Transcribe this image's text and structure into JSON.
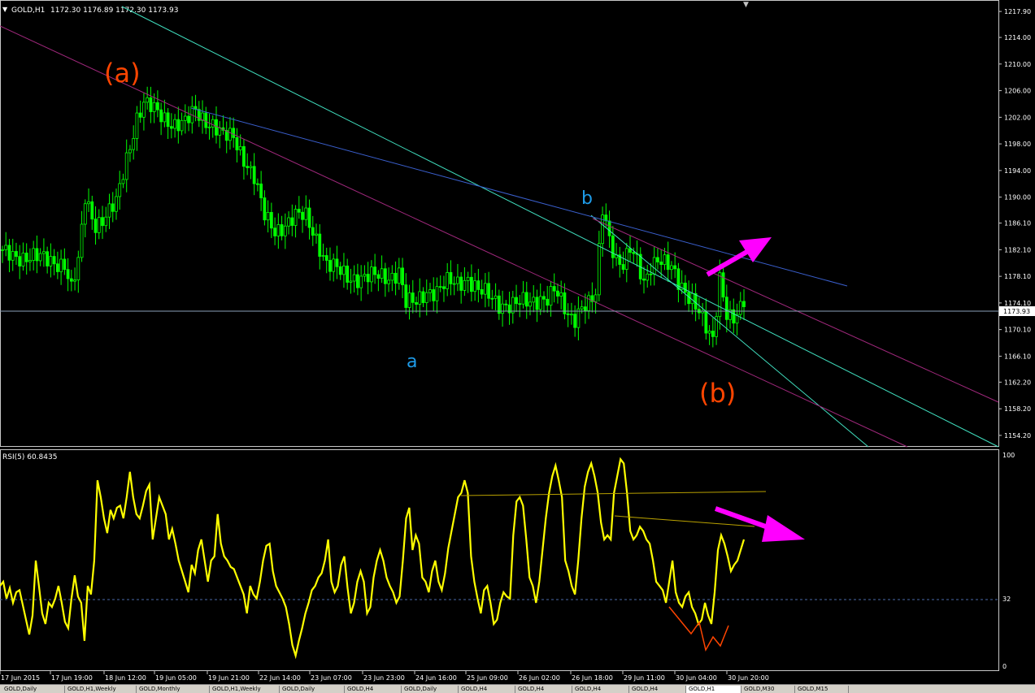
{
  "header": {
    "symbol_label": "GOLD,H1",
    "ohlc": "1172.30 1176.89 1172.30 1173.93"
  },
  "indicator": {
    "label": "RSI(5) 60.8435",
    "level_label": "32"
  },
  "annotations": {
    "wave_a_big": "(a)",
    "wave_b_big": "(b)",
    "wave_a_small": "a",
    "wave_b_small": "b"
  },
  "colors": {
    "background": "#000000",
    "candles": "#00ff00",
    "rsi_line": "#ffff00",
    "wave_big": "#ff4500",
    "wave_small": "#1e9be8",
    "arrow": "#ff00ff",
    "channel_cyan": "#40e0c0",
    "channel_magenta": "#a0287c",
    "trendline_blue": "#3a5fcd"
  },
  "tabs": [
    "GOLD,Daily",
    "GOLD,H1,Weekly",
    "GOLD,Monthly",
    "GOLD,H1,Weekly",
    "GOLD,Daily",
    "GOLD,H4",
    "GOLD,Daily",
    "GOLD,H4",
    "GOLD,H4",
    "GOLD,H4",
    "GOLD,H4",
    "GOLD,H1",
    "GOLD,M30",
    "GOLD,M15"
  ],
  "active_tab": 11,
  "chart_data": [
    {
      "type": "candlestick",
      "title": "GOLD,H1",
      "y_ticks": [
        "1217.90",
        "1214.00",
        "1210.00",
        "1206.00",
        "1202.00",
        "1198.00",
        "1194.00",
        "1190.00",
        "1186.10",
        "1182.10",
        "1178.10",
        "1174.10",
        "1170.10",
        "1166.10",
        "1162.20",
        "1158.20",
        "1154.20"
      ],
      "ylim": [
        1152.6,
        1219.5
      ],
      "current_price": "1173.93",
      "x_ticks": [
        "17 Jun 2015",
        "17 Jun 19:00",
        "18 Jun 12:00",
        "19 Jun 05:00",
        "19 Jun 21:00",
        "22 Jun 14:00",
        "23 Jun 07:00",
        "23 Jun 23:00",
        "24 Jun 16:00",
        "25 Jun 09:00",
        "26 Jun 02:00",
        "26 Jun 18:00",
        "29 Jun 11:00",
        "30 Jun 04:00",
        "30 Jun 20:00"
      ],
      "close_path": [
        [
          0,
          1181.5
        ],
        [
          8,
          1181
        ],
        [
          14,
          1180.5
        ],
        [
          18,
          1180
        ],
        [
          20,
          1176
        ],
        [
          22,
          1180
        ],
        [
          24,
          1190
        ],
        [
          27,
          1186
        ],
        [
          30,
          1187
        ],
        [
          33,
          1189
        ],
        [
          36,
          1196
        ],
        [
          39,
          1202
        ],
        [
          41,
          1204
        ],
        [
          44,
          1203
        ],
        [
          47,
          1202
        ],
        [
          50,
          1201
        ],
        [
          53,
          1201
        ],
        [
          56,
          1203
        ],
        [
          58,
          1202
        ],
        [
          61,
          1201
        ],
        [
          64,
          1199
        ],
        [
          67,
          1199
        ],
        [
          70,
          1196
        ],
        [
          73,
          1193
        ],
        [
          76,
          1187
        ],
        [
          79,
          1185
        ],
        [
          82,
          1186
        ],
        [
          85,
          1187
        ],
        [
          88,
          1187
        ],
        [
          91,
          1184
        ],
        [
          94,
          1180
        ],
        [
          97,
          1179
        ],
        [
          100,
          1178
        ],
        [
          103,
          1178
        ],
        [
          106,
          1178
        ],
        [
          109,
          1178
        ],
        [
          112,
          1178
        ],
        [
          115,
          1179
        ],
        [
          117,
          1174
        ],
        [
          120,
          1174
        ],
        [
          123,
          1176
        ],
        [
          126,
          1176
        ],
        [
          129,
          1177
        ],
        [
          132,
          1177
        ],
        [
          135,
          1178
        ],
        [
          138,
          1176
        ],
        [
          141,
          1175
        ],
        [
          144,
          1174
        ],
        [
          147,
          1174
        ],
        [
          150,
          1174
        ],
        [
          153,
          1174
        ],
        [
          156,
          1175
        ],
        [
          158,
          1175
        ],
        [
          160,
          1176
        ],
        [
          162,
          1174
        ],
        [
          164,
          1172
        ],
        [
          166,
          1172
        ],
        [
          168,
          1174
        ],
        [
          170,
          1174
        ],
        [
          172,
          1175
        ],
        [
          174,
          1188
        ],
        [
          176,
          1184
        ],
        [
          178,
          1181
        ],
        [
          180,
          1180
        ],
        [
          182,
          1182
        ],
        [
          184,
          1180
        ],
        [
          186,
          1177
        ],
        [
          188,
          1180
        ],
        [
          190,
          1181
        ],
        [
          192,
          1180
        ],
        [
          194,
          1179
        ],
        [
          196,
          1177
        ],
        [
          198,
          1176
        ],
        [
          200,
          1175
        ],
        [
          202,
          1173
        ],
        [
          204,
          1170
        ],
        [
          206,
          1168
        ],
        [
          208,
          1178
        ],
        [
          210,
          1173
        ],
        [
          212,
          1172
        ],
        [
          214,
          1173
        ],
        [
          215,
          1174
        ]
      ],
      "price_range": {
        "high": "1206 (18 Jun)",
        "low": "1166 (30 Jun)"
      }
    },
    {
      "type": "line",
      "title": "RSI(5) 60.8435",
      "y_ticks": [
        "100",
        "32",
        "0"
      ],
      "ylim": [
        0,
        100
      ],
      "level": 32,
      "series": [
        {
          "values": [
            38,
            40,
            32,
            37,
            30,
            35,
            36,
            29,
            22,
            15,
            24,
            50,
            38,
            25,
            20,
            30,
            28,
            32,
            38,
            30,
            21,
            18,
            32,
            43,
            33,
            30,
            12,
            38,
            34,
            50,
            88,
            80,
            70,
            63,
            74,
            70,
            75,
            76,
            70,
            80,
            92,
            80,
            72,
            70,
            76,
            83,
            86,
            60,
            70,
            80,
            76,
            72,
            60,
            65,
            58,
            50,
            45,
            40,
            35,
            48,
            44,
            55,
            60,
            50,
            40,
            50,
            52,
            72,
            58,
            52,
            50,
            47,
            46,
            42,
            38,
            34,
            25,
            38,
            34,
            32,
            40,
            50,
            57,
            58,
            45,
            38,
            35,
            32,
            28,
            20,
            10,
            5,
            12,
            18,
            25,
            30,
            36,
            38,
            42,
            44,
            50,
            60,
            40,
            35,
            38,
            48,
            52,
            37,
            25,
            30,
            40,
            45,
            40,
            25,
            28,
            42,
            50,
            55,
            50,
            42,
            38,
            35,
            30,
            33,
            50,
            70,
            75,
            55,
            62,
            58,
            42,
            40,
            35,
            45,
            50,
            40,
            36,
            44,
            56,
            64,
            72,
            80,
            82,
            88,
            82,
            52,
            40,
            32,
            25,
            36,
            38,
            30,
            20,
            22,
            30,
            35,
            33,
            32,
            62,
            78,
            80,
            76,
            60,
            42,
            38,
            30,
            40,
            55,
            70,
            82,
            90,
            95,
            88,
            80,
            50,
            45,
            38,
            34,
            50,
            70,
            85,
            92,
            96,
            90,
            82,
            68,
            60,
            62,
            60,
            82,
            90,
            98,
            96,
            82,
            64,
            60,
            62,
            66,
            64,
            60,
            58,
            50,
            40,
            38,
            36,
            30,
            40,
            50,
            35,
            30,
            28,
            33,
            35,
            28,
            25,
            20,
            22,
            30,
            24,
            20,
            35,
            55,
            62,
            58,
            52,
            45,
            48,
            50,
            55,
            60
          ]
        }
      ]
    }
  ]
}
